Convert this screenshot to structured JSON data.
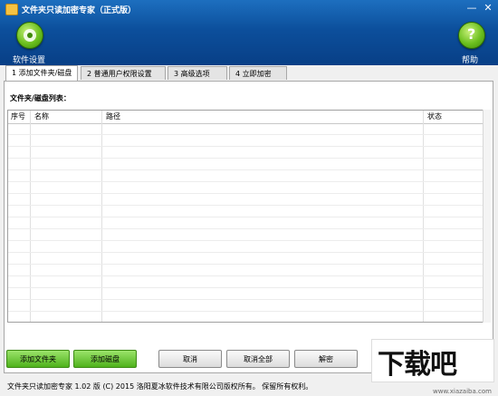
{
  "window": {
    "title": "文件夹只读加密专家（正式版）",
    "controls": {
      "minimize": "—",
      "close": "✕"
    }
  },
  "header": {
    "settings_label": "软件设置",
    "help_label": "帮助",
    "help_icon_char": "?"
  },
  "tabs": [
    {
      "label": "1 添加文件夹/磁盘"
    },
    {
      "label": "2 普通用户权限设置"
    },
    {
      "label": "3 高级选项"
    },
    {
      "label": "4 立即加密"
    }
  ],
  "list": {
    "caption": "文件夹/磁盘列表：",
    "columns": [
      "序号",
      "名称",
      "路径",
      "状态"
    ],
    "rows": []
  },
  "buttons": {
    "add_folder": "添加文件夹",
    "add_disk": "添加磁盘",
    "cancel": "取消",
    "cancel_all": "取消全部",
    "decrypt": "解密"
  },
  "status": {
    "text": "文件夹只读加密专家 1.02 版 (C) 2015 洛阳夏冰软件技术有限公司版权所有。 保留所有权利。"
  },
  "watermark": {
    "big": "下载吧",
    "small": "www.xiazaiba.com"
  },
  "colors": {
    "header": "#0c4f9c",
    "green_button": "#4fb21c"
  }
}
